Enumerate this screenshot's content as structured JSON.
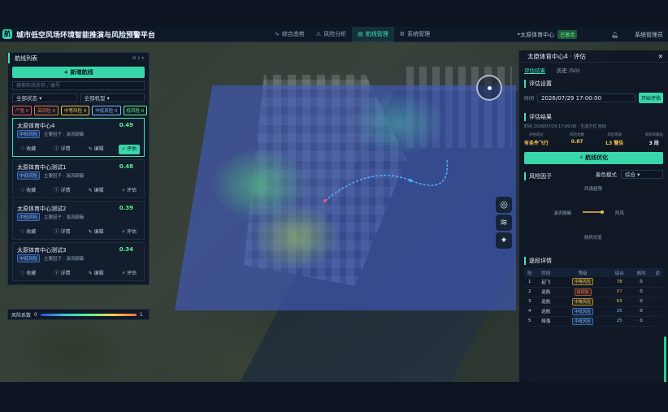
{
  "header": {
    "title": "城市低空风场环境智能推演与风险预警平台",
    "logo": "航",
    "nav": [
      {
        "icon": "∿",
        "label": "综合态势",
        "active": false
      },
      {
        "icon": "⚠",
        "label": "风险分析",
        "active": false
      },
      {
        "icon": "▤",
        "label": "航线管理",
        "active": true
      },
      {
        "icon": "⚙",
        "label": "系统管理",
        "active": false
      }
    ],
    "location": "太原体育中心",
    "status": "已激活",
    "user": "系统管理员"
  },
  "left_panel": {
    "title": "航线列表",
    "tools": "⊞ ⇕ ▾",
    "new_button": "+ 新增航线",
    "search_placeholder": "搜索航线名称 / 编号",
    "status_filter": "全部状态 ▾",
    "model_filter": "全部机型 ▾",
    "tags": [
      {
        "label": "严重 0",
        "color": "#f05a5a"
      },
      {
        "label": "高风险 0",
        "color": "#f07a4a"
      },
      {
        "label": "中等风险 4",
        "color": "#f0c04a"
      },
      {
        "label": "中低风险 0",
        "color": "#7fb7ff"
      },
      {
        "label": "低风险 0",
        "color": "#5ef08f"
      }
    ],
    "routes": [
      {
        "name": "太原体育中心4",
        "score": "0.49",
        "level": "中低风险",
        "factor": "主要因子 · 湍流颠簸"
      },
      {
        "name": "太原体育中心测试1",
        "score": "0.48",
        "level": "中低风险",
        "factor": "主要因子 · 湍流颠簸"
      },
      {
        "name": "太原体育中心测试2",
        "score": "0.39",
        "level": "中低风险",
        "factor": "主要因子 · 湍流颠簸"
      },
      {
        "name": "太原体育中心测试3",
        "score": "0.34",
        "level": "中低风险",
        "factor": "主要因子 · 湍流颠簸"
      }
    ],
    "actions": {
      "collect": "♡ 收藏",
      "detail": "ⓘ 详情",
      "edit": "✎ 编辑",
      "evaluate": "⚡ 评估"
    }
  },
  "legend": {
    "label": "风险系数",
    "min": "0",
    "max": "1"
  },
  "right_panel": {
    "title": "太原体育中心4 · 评估",
    "close": "✕",
    "tabs": [
      {
        "label": "评估结果",
        "active": true
      },
      {
        "label": "历史 (50)",
        "active": false
      }
    ],
    "settings_title": "评估设置",
    "time_label": "时间",
    "time_value": "2026/07/29 17:00:00",
    "evaluate_button": "开始评估",
    "results_title": "评估结果",
    "results_meta": "时间 2026/07/29 17:00:00 · 生成方式 自动",
    "metrics": [
      {
        "key": "评估结论",
        "value": "有条件飞行",
        "color": "#f0c04a"
      },
      {
        "key": "风险指数",
        "value": "0.87",
        "color": "#f0c04a"
      },
      {
        "key": "风险等级",
        "value": "L3 警告",
        "color": "#f0c04a"
      },
      {
        "key": "受影响路段",
        "value": "3 段",
        "color": "#e6eef8"
      }
    ],
    "optimize_button": "⚡ 航线优化",
    "factors_title": "风险因子",
    "mode_label": "着色模式",
    "mode_value": "综合 ▾",
    "factor_labels": {
      "top": "风速超限",
      "left": "湍流颠簸",
      "right": "阵风",
      "bottom": "侧风切变"
    },
    "segments_title": "逐段详情",
    "segment_headers": [
      "段",
      "阶段",
      "等级",
      "综合",
      "侧风",
      "逆"
    ],
    "segments": [
      {
        "no": "1",
        "phase": "起飞",
        "level": "中等风险",
        "lc": "mid",
        "score": "78",
        "sc": "#f0c04a",
        "side": "0"
      },
      {
        "no": "2",
        "phase": "巡航",
        "level": "高风险",
        "lc": "high",
        "score": "87",
        "sc": "#f07a4a",
        "side": "0"
      },
      {
        "no": "3",
        "phase": "巡航",
        "level": "中等风险",
        "lc": "mid",
        "score": "63",
        "sc": "#f0c04a",
        "side": "0"
      },
      {
        "no": "4",
        "phase": "巡航",
        "level": "中低风险",
        "lc": "low",
        "score": "25",
        "sc": "#7fb7ff",
        "side": "0"
      },
      {
        "no": "5",
        "phase": "降落",
        "level": "中低风险",
        "lc": "low",
        "score": "25",
        "sc": "#7fb7ff",
        "side": "0"
      }
    ]
  },
  "map_controls": [
    "◎",
    "≋",
    "✦"
  ]
}
